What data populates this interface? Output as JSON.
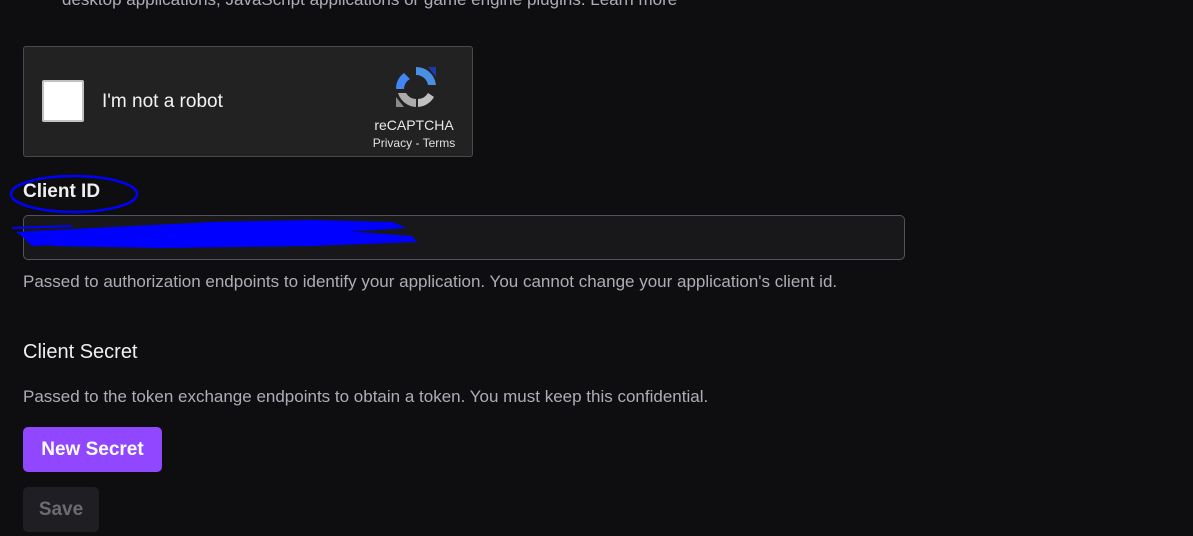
{
  "top_help_text": "desktop applications, JavaScript applications or game engine plugins. Learn more",
  "recaptcha": {
    "label": "I'm not a robot",
    "brand": "reCAPTCHA",
    "privacy": "Privacy",
    "separator": " - ",
    "terms": "Terms",
    "checked": false
  },
  "client_id": {
    "label": "Client ID",
    "value": "",
    "redacted": true,
    "help": "Passed to authorization endpoints to identify your application. You cannot change your application's client id."
  },
  "client_secret": {
    "label": "Client Secret",
    "help": "Passed to the token exchange endpoints to obtain a token. You must keep this confidential."
  },
  "buttons": {
    "new_secret": "New Secret",
    "save": "Save"
  },
  "colors": {
    "background": "#0e0e10",
    "accent": "#9147ff",
    "annotation": "#0000ff"
  },
  "icons": {
    "recaptcha_logo": "recaptcha-logo-icon"
  }
}
